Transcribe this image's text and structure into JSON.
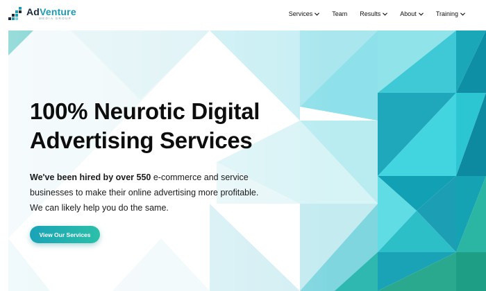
{
  "brand": {
    "name_part1": "Ad",
    "name_part2": "Venture",
    "tagline": "Media Group",
    "primary_color": "#1d9bb3",
    "dark_color": "#1b2a3a"
  },
  "nav": {
    "items": [
      {
        "label": "Services",
        "has_dropdown": true
      },
      {
        "label": "Team",
        "has_dropdown": false
      },
      {
        "label": "Results",
        "has_dropdown": true
      },
      {
        "label": "About",
        "has_dropdown": true
      },
      {
        "label": "Training",
        "has_dropdown": true
      }
    ]
  },
  "hero": {
    "headline_line1": "100% Neurotic Digital",
    "headline_line2": "Advertising Services",
    "lede_bold": "We've been hired by over 550",
    "lede_rest": " e-commerce and service businesses to make their online advertising more profitable. We can likely help you do the same.",
    "cta_label": "View Our Services",
    "accent_colors": [
      "#1aa3b7",
      "#2cbfa8",
      "#3fd3e0",
      "#0f8fa6"
    ]
  }
}
